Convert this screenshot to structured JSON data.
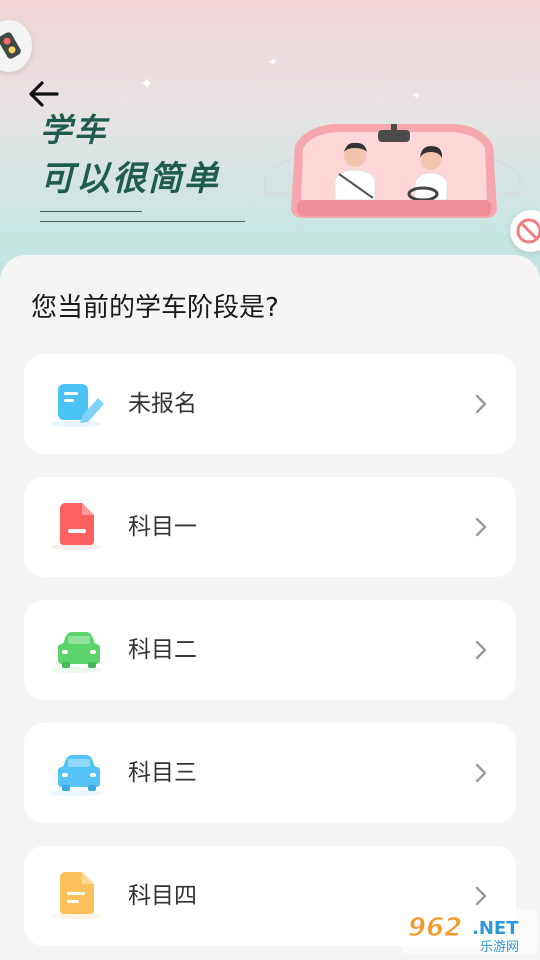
{
  "hero": {
    "slogan_line1": "学车",
    "slogan_line2": "可以很简单"
  },
  "question": "您当前的学车阶段是?",
  "options": [
    {
      "label": "未报名",
      "icon": "form-pen-icon",
      "color": "#4cc3f5"
    },
    {
      "label": "科目一",
      "icon": "document-icon",
      "color": "#ff6161"
    },
    {
      "label": "科目二",
      "icon": "car-icon",
      "color": "#5ad46b"
    },
    {
      "label": "科目三",
      "icon": "car-icon",
      "color": "#56c3f6"
    },
    {
      "label": "科目四",
      "icon": "document-lines-icon",
      "color": "#ffc15c"
    }
  ],
  "watermark": {
    "main": "962.NET",
    "sub": "乐游网"
  }
}
